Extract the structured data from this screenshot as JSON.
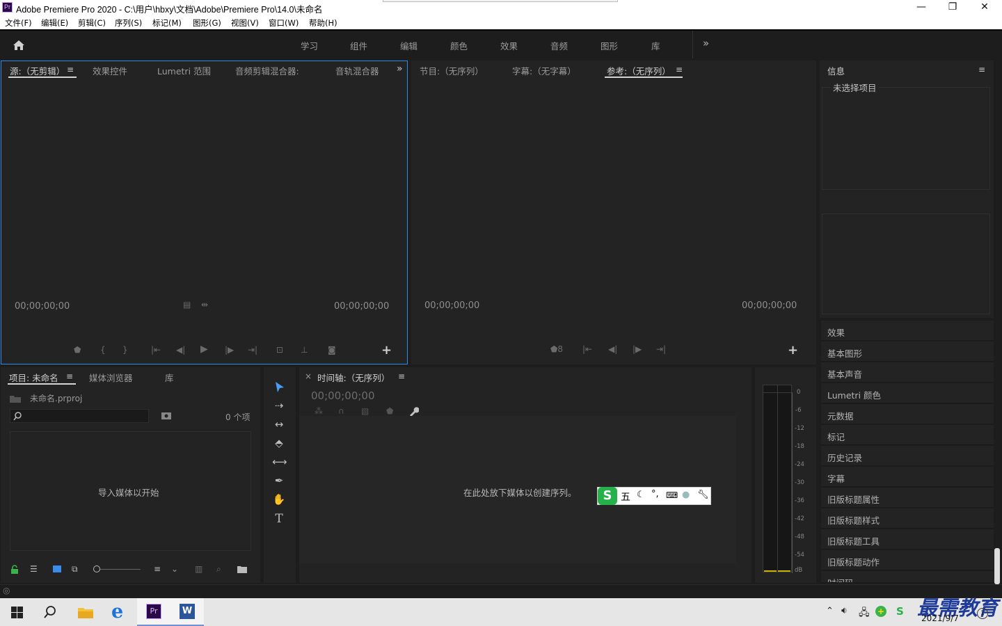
{
  "window": {
    "app_icon": "Pr",
    "title": "Adobe Premiere Pro 2020 - C:\\用户\\hbxy\\文档\\Adobe\\Premiere Pro\\14.0\\未命名",
    "minimize": "—",
    "maximize": "❐",
    "close": "✕"
  },
  "menu": [
    "文件(F)",
    "编辑(E)",
    "剪辑(C)",
    "序列(S)",
    "标记(M)",
    "图形(G)",
    "视图(V)",
    "窗口(W)",
    "帮助(H)"
  ],
  "workspaces": [
    "学习",
    "组件",
    "编辑",
    "颜色",
    "效果",
    "音频",
    "图形",
    "库"
  ],
  "workspaces_more": "»",
  "source_panel": {
    "tabs": [
      "源:（无剪辑）",
      "效果控件",
      "Lumetri 范围",
      "音频剪辑混合器:",
      "音轨混合器"
    ],
    "menu_icon": "≡",
    "overflow": "»",
    "timecode_left": "00;00;00;00",
    "timecode_right": "00;00;00;00",
    "add": "+"
  },
  "program_panel": {
    "tabs": [
      "节目:（无序列）",
      "字幕:（无字幕）",
      "参考:（无序列）"
    ],
    "menu_icon": "≡",
    "timecode_left": "00;00;00;00",
    "timecode_right": "00;00;00;00",
    "add": "+"
  },
  "info_panel": {
    "title": "信息",
    "menu_icon": "≡",
    "no_selection": "未选择项目"
  },
  "right_list": [
    "效果",
    "基本图形",
    "基本声音",
    "Lumetri 颜色",
    "元数据",
    "标记",
    "历史记录",
    "字幕",
    "旧版标题属性",
    "旧版标题样式",
    "旧版标题工具",
    "旧版标题动作",
    "时间码"
  ],
  "project_panel": {
    "tabs": [
      "项目: 未命名",
      "媒体浏览器",
      "库"
    ],
    "menu_icon": "≡",
    "project_file": "未命名.prproj",
    "search_placeholder": "",
    "item_count": "0 个项",
    "empty_text": "导入媒体以开始"
  },
  "timeline_panel": {
    "close": "×",
    "title": "时间轴:（无序列）",
    "menu_icon": "≡",
    "timecode": "00;00;00;00",
    "empty_text": "在此处放下媒体以创建序列。"
  },
  "audio_meter": {
    "ticks": [
      "0",
      "-6",
      "-12",
      "-18",
      "-24",
      "-30",
      "-36",
      "-42",
      "-48",
      "-54",
      "dB"
    ]
  },
  "ime_toolbar": {
    "logo": "S",
    "mode": "五",
    "icons": [
      "moon-icon",
      "punctuation-icon",
      "keyboard-icon",
      "user-icon",
      "wrench-icon"
    ]
  },
  "taskbar": {
    "date": "2021/9/7",
    "watermark": "最需教育",
    "notification_count": "1"
  },
  "colors": {
    "accent_focus": "#2d8ceb",
    "premiere_purple": "#2a0a46",
    "meter_yellow": "#c8b400",
    "ime_green": "#27b14a"
  }
}
